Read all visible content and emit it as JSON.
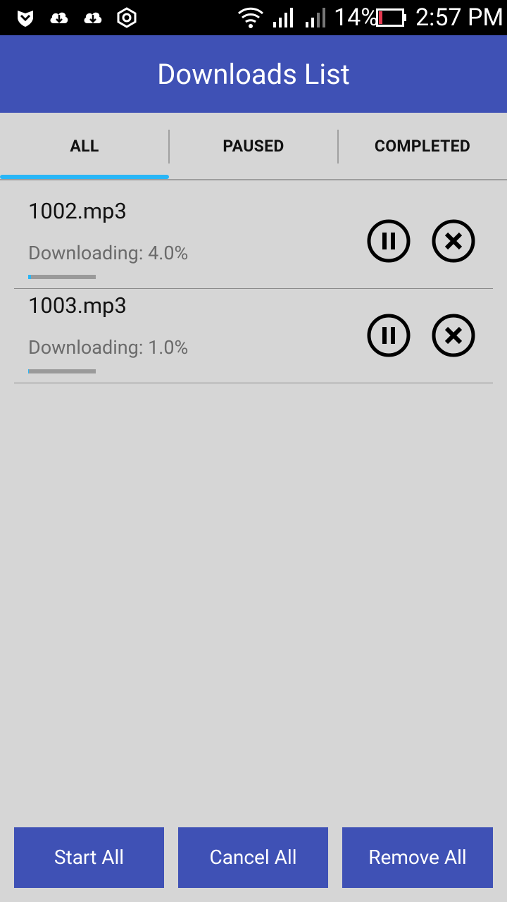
{
  "status_bar": {
    "icons": [
      "shield-icon",
      "cloud-download-icon",
      "cloud-download-icon",
      "settings-hex-icon",
      "wifi-icon",
      "signal-icon",
      "signal-icon",
      "battery-icon"
    ],
    "battery": "14%",
    "time": "2:57 PM"
  },
  "app_bar": {
    "title": "Downloads List"
  },
  "tabs": [
    {
      "label": "ALL",
      "selected": true
    },
    {
      "label": "PAUSED",
      "selected": false
    },
    {
      "label": "COMPLETED",
      "selected": false
    }
  ],
  "downloads": [
    {
      "name": "1002.mp3",
      "status": "Downloading: 4.0%",
      "progress": 0.04,
      "actions": [
        "pause-icon",
        "cancel-icon"
      ]
    },
    {
      "name": "1003.mp3",
      "status": "Downloading: 1.0%",
      "progress": 0.01,
      "actions": [
        "pause-icon",
        "cancel-icon"
      ]
    }
  ],
  "buttons": {
    "start_all": "Start All",
    "cancel_all": "Cancel All",
    "remove_all": "Remove All"
  },
  "colors": {
    "primary": "#3f51b5",
    "accent": "#29b6f6",
    "background": "#d6d6d6"
  }
}
